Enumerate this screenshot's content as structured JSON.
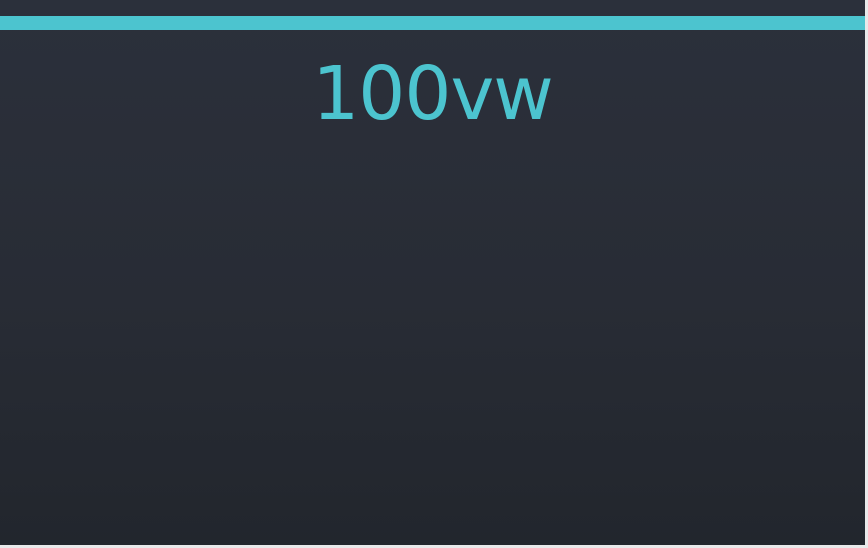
{
  "caption": {
    "text": "100vw"
  },
  "colors": {
    "accent": "#4cc4cf",
    "background": "#282c35"
  }
}
